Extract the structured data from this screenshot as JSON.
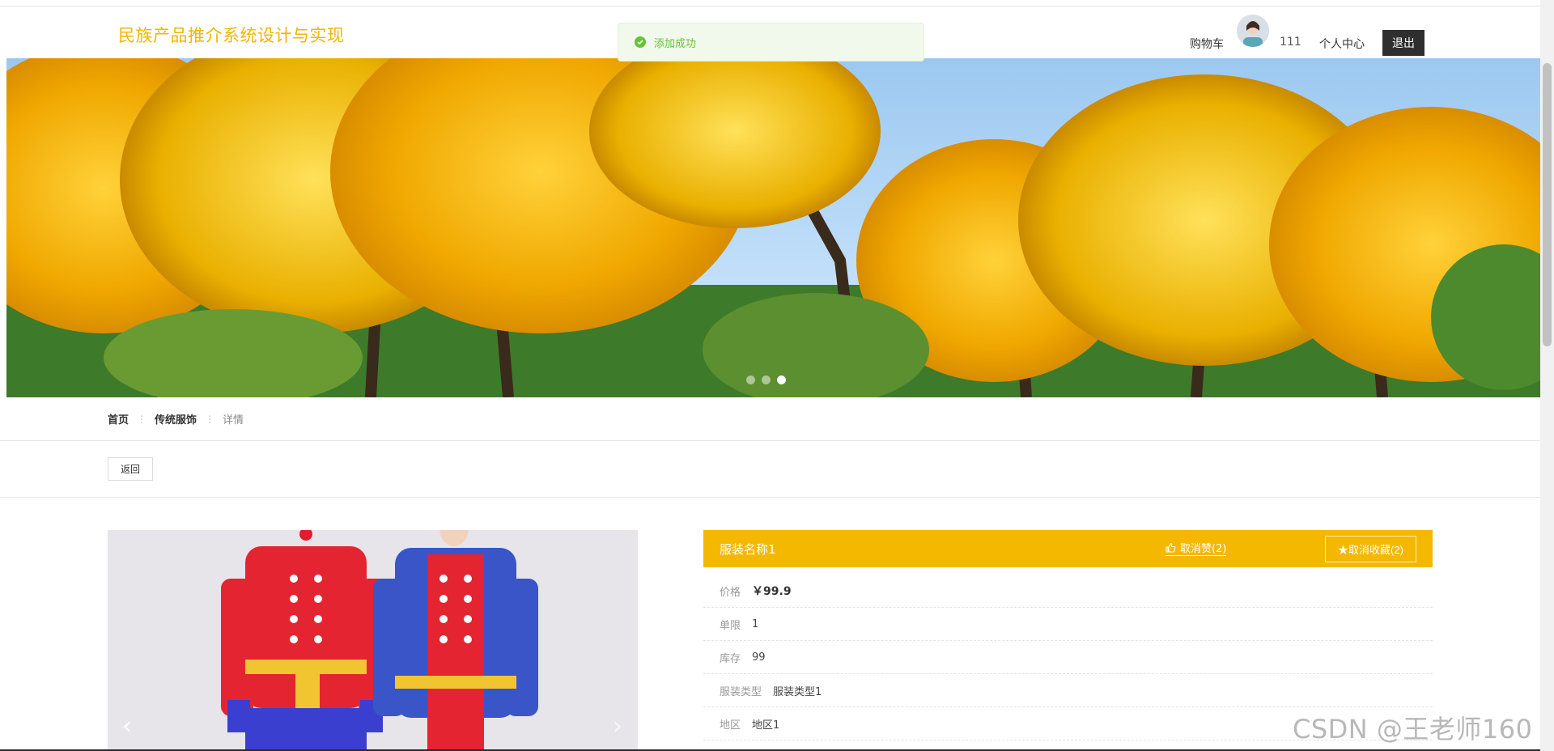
{
  "header": {
    "site_title": "民族产品推介系统设计与实现",
    "cart": "购物车",
    "username": "111",
    "profile": "个人中心",
    "logout": "退出"
  },
  "toast": {
    "message": "添加成功"
  },
  "banner": {
    "slide_count": 3,
    "active_slide": 3
  },
  "breadcrumb": {
    "items": [
      "首页",
      "传统服饰",
      "详情"
    ]
  },
  "back_button": "返回",
  "product": {
    "title": "服装名称1",
    "like_label": "取消赞(2)",
    "favorite_label": "★取消收藏(2)",
    "fields": [
      {
        "key": "价格",
        "value": "￥99.9"
      },
      {
        "key": "单限",
        "value": "1"
      },
      {
        "key": "库存",
        "value": "99"
      },
      {
        "key": "服装类型",
        "value": "服装类型1"
      },
      {
        "key": "地区",
        "value": "地区1"
      }
    ]
  },
  "watermark": "CSDN @王老师160",
  "colors": {
    "accent": "#f4b800",
    "title": "#f2b600",
    "success": "#67c23a"
  }
}
